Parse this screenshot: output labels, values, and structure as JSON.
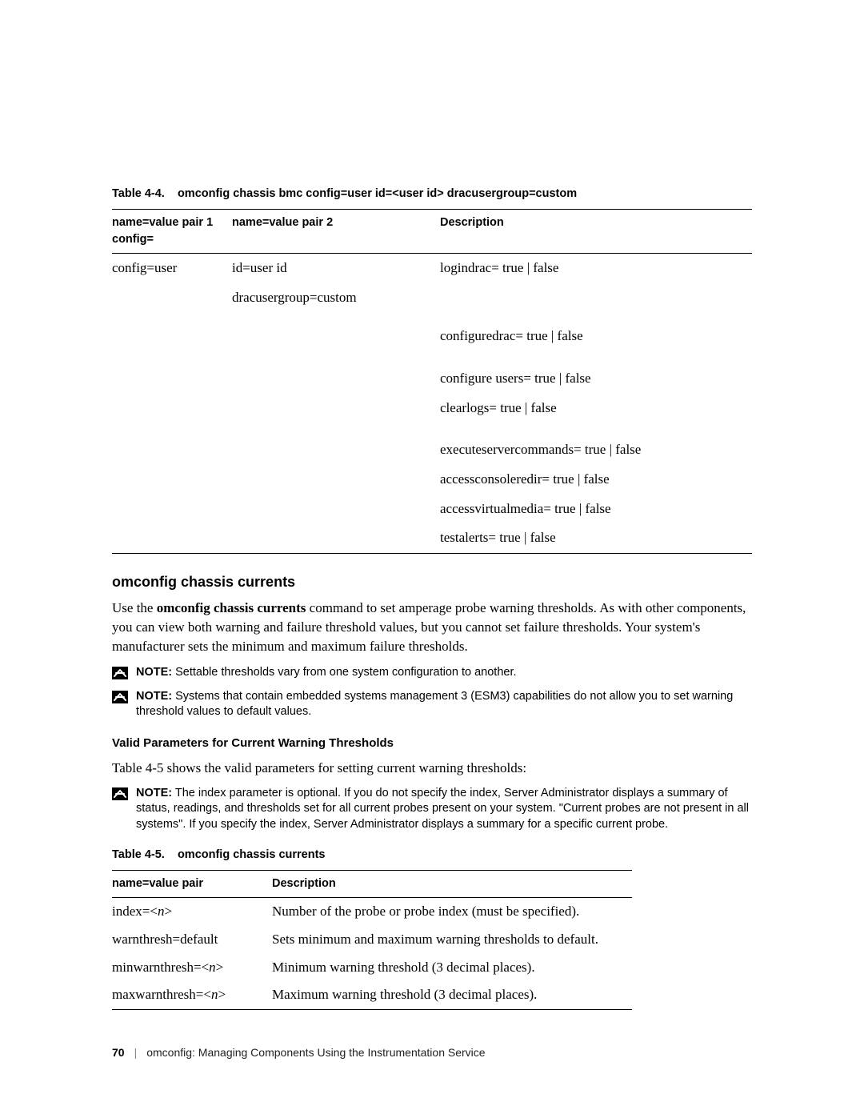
{
  "table44": {
    "caption_label": "Table 4-4.",
    "caption_title": "omconfig chassis bmc config=user id=<user id> dracusergroup=custom",
    "headers": {
      "col1a": "name=value pair 1",
      "col1b": "config=",
      "col2": "name=value pair 2",
      "col3": "Description"
    },
    "col1_value": "config=user",
    "col2_row1": "id=user id",
    "col2_row2": "dracusergroup=custom",
    "desc": {
      "r1": "logindrac= true | false",
      "r2": "configuredrac= true | false",
      "r3": "configure users= true | false",
      "r4": "clearlogs= true | false",
      "r5": "executeservercommands= true | false",
      "r6": "accessconsoleredir= true | false",
      "r7": "accessvirtualmedia= true | false",
      "r8": "testalerts= true | false"
    }
  },
  "section": {
    "heading": "omconfig chassis currents",
    "body_pre": "Use the ",
    "body_cmd": "omconfig chassis currents",
    "body_post": " command to set amperage probe warning thresholds. As with other components, you can view both warning and failure threshold values, but you cannot set failure thresholds. Your system's manufacturer sets the minimum and maximum failure thresholds."
  },
  "notes": {
    "label": "NOTE:",
    "n1": " Settable thresholds vary from one system configuration to another.",
    "n2": " Systems that contain embedded systems management 3 (ESM3) capabilities do not allow you to set warning threshold values to default values.",
    "n3": " The index parameter is optional. If you do not specify the index, Server Administrator displays a summary of status, readings, and thresholds set for all current probes present on your system. \"Current probes are not present in all systems\". If you specify the index, Server Administrator displays a summary for a specific current probe."
  },
  "subheading": "Valid Parameters for Current Warning Thresholds",
  "body2": "Table 4-5 shows the valid parameters for setting current warning thresholds:",
  "table45": {
    "caption_label": "Table 4-5.",
    "caption_title": "omconfig chassis currents",
    "headers": {
      "name": "name=value pair",
      "desc": "Description"
    },
    "rows": [
      {
        "name_pre": "index=<",
        "name_var": "n",
        "name_post": ">",
        "desc": "Number of the probe or probe index (must be specified)."
      },
      {
        "name_pre": "warnthresh=default",
        "name_var": "",
        "name_post": "",
        "desc": "Sets minimum and maximum warning thresholds to default."
      },
      {
        "name_pre": "minwarnthresh=<",
        "name_var": "n",
        "name_post": ">",
        "desc": "Minimum warning threshold (3 decimal places)."
      },
      {
        "name_pre": "maxwarnthresh=<",
        "name_var": "n",
        "name_post": ">",
        "desc": "Maximum warning threshold (3 decimal places)."
      }
    ]
  },
  "footer": {
    "page_num": "70",
    "separator": "|",
    "title": "omconfig: Managing Components Using the Instrumentation Service"
  }
}
